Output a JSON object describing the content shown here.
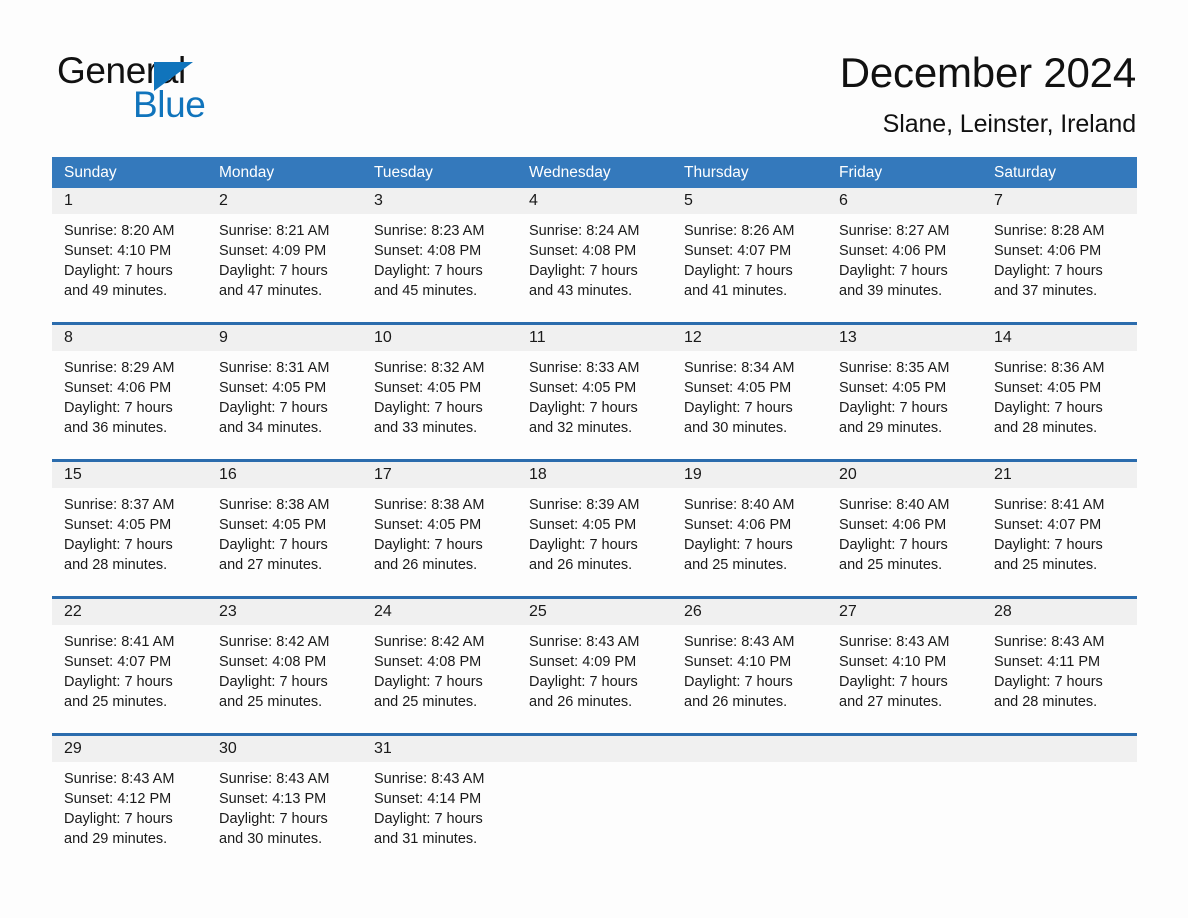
{
  "brand": {
    "name_part1": "General",
    "name_part2": "Blue",
    "accent_color": "#1074bc",
    "logo_icon": "triangle-mark"
  },
  "header": {
    "title": "December 2024",
    "location": "Slane, Leinster, Ireland"
  },
  "calendar": {
    "header_bg": "#3479bc",
    "header_text_color": "#ffffff",
    "rule_color": "#2b6cad",
    "daynum_bg": "#f0f0f0",
    "weekdays": [
      "Sunday",
      "Monday",
      "Tuesday",
      "Wednesday",
      "Thursday",
      "Friday",
      "Saturday"
    ],
    "weeks": [
      {
        "days": [
          {
            "num": "1",
            "sunrise": "Sunrise: 8:20 AM",
            "sunset": "Sunset: 4:10 PM",
            "daylight1": "Daylight: 7 hours",
            "daylight2": "and 49 minutes."
          },
          {
            "num": "2",
            "sunrise": "Sunrise: 8:21 AM",
            "sunset": "Sunset: 4:09 PM",
            "daylight1": "Daylight: 7 hours",
            "daylight2": "and 47 minutes."
          },
          {
            "num": "3",
            "sunrise": "Sunrise: 8:23 AM",
            "sunset": "Sunset: 4:08 PM",
            "daylight1": "Daylight: 7 hours",
            "daylight2": "and 45 minutes."
          },
          {
            "num": "4",
            "sunrise": "Sunrise: 8:24 AM",
            "sunset": "Sunset: 4:08 PM",
            "daylight1": "Daylight: 7 hours",
            "daylight2": "and 43 minutes."
          },
          {
            "num": "5",
            "sunrise": "Sunrise: 8:26 AM",
            "sunset": "Sunset: 4:07 PM",
            "daylight1": "Daylight: 7 hours",
            "daylight2": "and 41 minutes."
          },
          {
            "num": "6",
            "sunrise": "Sunrise: 8:27 AM",
            "sunset": "Sunset: 4:06 PM",
            "daylight1": "Daylight: 7 hours",
            "daylight2": "and 39 minutes."
          },
          {
            "num": "7",
            "sunrise": "Sunrise: 8:28 AM",
            "sunset": "Sunset: 4:06 PM",
            "daylight1": "Daylight: 7 hours",
            "daylight2": "and 37 minutes."
          }
        ]
      },
      {
        "days": [
          {
            "num": "8",
            "sunrise": "Sunrise: 8:29 AM",
            "sunset": "Sunset: 4:06 PM",
            "daylight1": "Daylight: 7 hours",
            "daylight2": "and 36 minutes."
          },
          {
            "num": "9",
            "sunrise": "Sunrise: 8:31 AM",
            "sunset": "Sunset: 4:05 PM",
            "daylight1": "Daylight: 7 hours",
            "daylight2": "and 34 minutes."
          },
          {
            "num": "10",
            "sunrise": "Sunrise: 8:32 AM",
            "sunset": "Sunset: 4:05 PM",
            "daylight1": "Daylight: 7 hours",
            "daylight2": "and 33 minutes."
          },
          {
            "num": "11",
            "sunrise": "Sunrise: 8:33 AM",
            "sunset": "Sunset: 4:05 PM",
            "daylight1": "Daylight: 7 hours",
            "daylight2": "and 32 minutes."
          },
          {
            "num": "12",
            "sunrise": "Sunrise: 8:34 AM",
            "sunset": "Sunset: 4:05 PM",
            "daylight1": "Daylight: 7 hours",
            "daylight2": "and 30 minutes."
          },
          {
            "num": "13",
            "sunrise": "Sunrise: 8:35 AM",
            "sunset": "Sunset: 4:05 PM",
            "daylight1": "Daylight: 7 hours",
            "daylight2": "and 29 minutes."
          },
          {
            "num": "14",
            "sunrise": "Sunrise: 8:36 AM",
            "sunset": "Sunset: 4:05 PM",
            "daylight1": "Daylight: 7 hours",
            "daylight2": "and 28 minutes."
          }
        ]
      },
      {
        "days": [
          {
            "num": "15",
            "sunrise": "Sunrise: 8:37 AM",
            "sunset": "Sunset: 4:05 PM",
            "daylight1": "Daylight: 7 hours",
            "daylight2": "and 28 minutes."
          },
          {
            "num": "16",
            "sunrise": "Sunrise: 8:38 AM",
            "sunset": "Sunset: 4:05 PM",
            "daylight1": "Daylight: 7 hours",
            "daylight2": "and 27 minutes."
          },
          {
            "num": "17",
            "sunrise": "Sunrise: 8:38 AM",
            "sunset": "Sunset: 4:05 PM",
            "daylight1": "Daylight: 7 hours",
            "daylight2": "and 26 minutes."
          },
          {
            "num": "18",
            "sunrise": "Sunrise: 8:39 AM",
            "sunset": "Sunset: 4:05 PM",
            "daylight1": "Daylight: 7 hours",
            "daylight2": "and 26 minutes."
          },
          {
            "num": "19",
            "sunrise": "Sunrise: 8:40 AM",
            "sunset": "Sunset: 4:06 PM",
            "daylight1": "Daylight: 7 hours",
            "daylight2": "and 25 minutes."
          },
          {
            "num": "20",
            "sunrise": "Sunrise: 8:40 AM",
            "sunset": "Sunset: 4:06 PM",
            "daylight1": "Daylight: 7 hours",
            "daylight2": "and 25 minutes."
          },
          {
            "num": "21",
            "sunrise": "Sunrise: 8:41 AM",
            "sunset": "Sunset: 4:07 PM",
            "daylight1": "Daylight: 7 hours",
            "daylight2": "and 25 minutes."
          }
        ]
      },
      {
        "days": [
          {
            "num": "22",
            "sunrise": "Sunrise: 8:41 AM",
            "sunset": "Sunset: 4:07 PM",
            "daylight1": "Daylight: 7 hours",
            "daylight2": "and 25 minutes."
          },
          {
            "num": "23",
            "sunrise": "Sunrise: 8:42 AM",
            "sunset": "Sunset: 4:08 PM",
            "daylight1": "Daylight: 7 hours",
            "daylight2": "and 25 minutes."
          },
          {
            "num": "24",
            "sunrise": "Sunrise: 8:42 AM",
            "sunset": "Sunset: 4:08 PM",
            "daylight1": "Daylight: 7 hours",
            "daylight2": "and 25 minutes."
          },
          {
            "num": "25",
            "sunrise": "Sunrise: 8:43 AM",
            "sunset": "Sunset: 4:09 PM",
            "daylight1": "Daylight: 7 hours",
            "daylight2": "and 26 minutes."
          },
          {
            "num": "26",
            "sunrise": "Sunrise: 8:43 AM",
            "sunset": "Sunset: 4:10 PM",
            "daylight1": "Daylight: 7 hours",
            "daylight2": "and 26 minutes."
          },
          {
            "num": "27",
            "sunrise": "Sunrise: 8:43 AM",
            "sunset": "Sunset: 4:10 PM",
            "daylight1": "Daylight: 7 hours",
            "daylight2": "and 27 minutes."
          },
          {
            "num": "28",
            "sunrise": "Sunrise: 8:43 AM",
            "sunset": "Sunset: 4:11 PM",
            "daylight1": "Daylight: 7 hours",
            "daylight2": "and 28 minutes."
          }
        ]
      },
      {
        "days": [
          {
            "num": "29",
            "sunrise": "Sunrise: 8:43 AM",
            "sunset": "Sunset: 4:12 PM",
            "daylight1": "Daylight: 7 hours",
            "daylight2": "and 29 minutes."
          },
          {
            "num": "30",
            "sunrise": "Sunrise: 8:43 AM",
            "sunset": "Sunset: 4:13 PM",
            "daylight1": "Daylight: 7 hours",
            "daylight2": "and 30 minutes."
          },
          {
            "num": "31",
            "sunrise": "Sunrise: 8:43 AM",
            "sunset": "Sunset: 4:14 PM",
            "daylight1": "Daylight: 7 hours",
            "daylight2": "and 31 minutes."
          },
          {
            "num": "",
            "sunrise": "",
            "sunset": "",
            "daylight1": "",
            "daylight2": ""
          },
          {
            "num": "",
            "sunrise": "",
            "sunset": "",
            "daylight1": "",
            "daylight2": ""
          },
          {
            "num": "",
            "sunrise": "",
            "sunset": "",
            "daylight1": "",
            "daylight2": ""
          },
          {
            "num": "",
            "sunrise": "",
            "sunset": "",
            "daylight1": "",
            "daylight2": ""
          }
        ]
      }
    ]
  }
}
